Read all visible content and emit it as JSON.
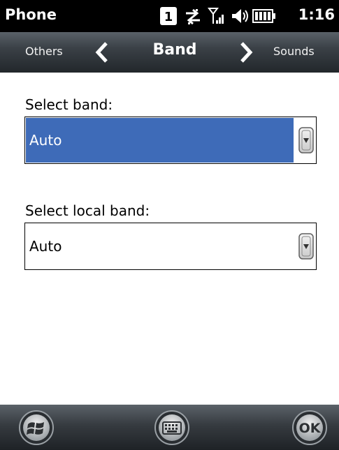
{
  "status_bar": {
    "app_title": "Phone",
    "clock": "1:16",
    "badge_count": "1",
    "icons": [
      "notification-badge-icon",
      "data-sync-icon",
      "signal-strength-icon",
      "speaker-icon",
      "battery-icon"
    ]
  },
  "nav": {
    "previous_label": "Others",
    "current_label": "Band",
    "next_label": "Sounds"
  },
  "form": {
    "band_label": "Select band:",
    "band_value": "Auto",
    "local_band_label": "Select local band:",
    "local_band_value": "Auto"
  },
  "softkeys": {
    "start_icon": "windows-start-icon",
    "keyboard_icon": "keyboard-icon",
    "ok_label": "OK"
  },
  "colors": {
    "selection": "#3e6bb8",
    "status_bar": "#000000",
    "nav_bar": "#3a4046"
  }
}
